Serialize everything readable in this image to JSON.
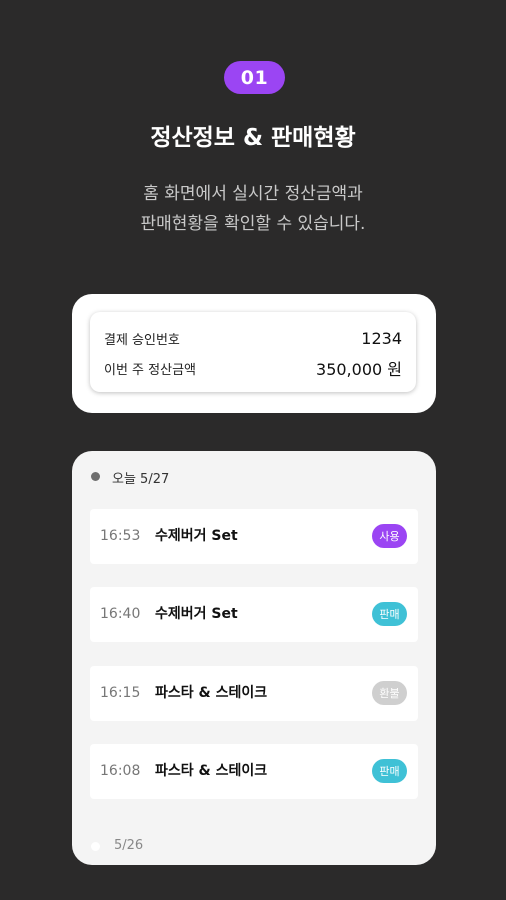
{
  "step": "01",
  "title": "정산정보 & 판매현황",
  "subtitle": {
    "line1": "홈 화면에서 실시간 정산금액과",
    "line2": "판매현황을 확인할 수 있습니다."
  },
  "settlement": {
    "approval_label": "결제 승인번호",
    "approval_value": "1234",
    "weekly_label": "이번 주 정산금액",
    "weekly_value": "350,000 원"
  },
  "history": {
    "today_label": "오늘 5/27",
    "transactions": [
      {
        "time": "16:53",
        "name": "수제버거 Set",
        "status": "사용",
        "color": "#9b45f3"
      },
      {
        "time": "16:40",
        "name": "수제버거 Set",
        "status": "판매",
        "color": "#3fc1d6"
      },
      {
        "time": "16:15",
        "name": "파스타 & 스테이크",
        "status": "환불",
        "color": "#cfcfcf"
      },
      {
        "time": "16:08",
        "name": "파스타 & 스테이크",
        "status": "판매",
        "color": "#3fc1d6"
      }
    ],
    "prev_label": "5/26"
  },
  "colors": {
    "background": "#2b2a2a",
    "accent": "#9b45f3",
    "sale": "#3fc1d6",
    "refund": "#cfcfcf"
  }
}
